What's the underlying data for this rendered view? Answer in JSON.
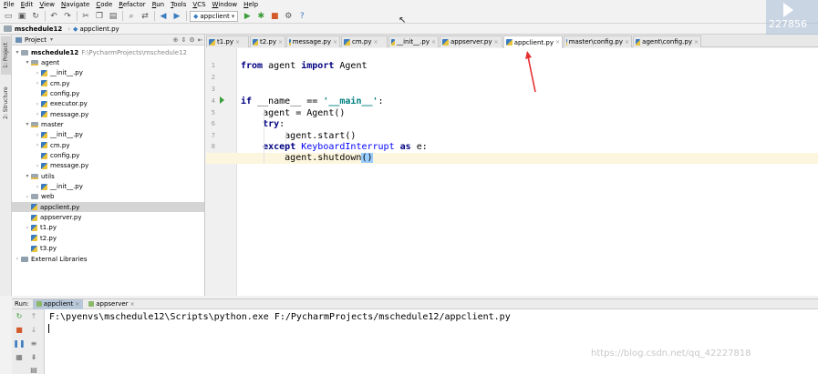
{
  "menu": [
    "File",
    "Edit",
    "View",
    "Navigate",
    "Code",
    "Refactor",
    "Run",
    "Tools",
    "VCS",
    "Window",
    "Help"
  ],
  "toolbar": {
    "run_config": "appclient",
    "icons": [
      "folder-open-icon",
      "save-icon",
      "sync-icon",
      "back-icon",
      "forward-icon",
      "cut-icon",
      "copy-icon",
      "paste-icon",
      "find-icon",
      "replace-icon",
      "nav-back-icon",
      "nav-forward-icon",
      "run-icon",
      "debug-icon",
      "stop-icon",
      "settings-icon",
      "help-icon"
    ]
  },
  "breadcrumb": {
    "project": "mschedule12",
    "file": "appclient.py"
  },
  "side_tabs": [
    "1: Project",
    "2: Structure"
  ],
  "project_panel": {
    "title": "Project",
    "tree": [
      {
        "depth": 0,
        "arrow": "▾",
        "icon": "folder",
        "label": "mschedule12",
        "path": "F:\\PycharmProjects\\mschedule12",
        "bold": true
      },
      {
        "depth": 1,
        "arrow": "▾",
        "icon": "pkg",
        "label": "agent"
      },
      {
        "depth": 2,
        "arrow": "›",
        "icon": "py",
        "label": "__init__.py"
      },
      {
        "depth": 2,
        "arrow": "›",
        "icon": "py",
        "label": "cm.py"
      },
      {
        "depth": 2,
        "arrow": "",
        "icon": "py",
        "label": "config.py"
      },
      {
        "depth": 2,
        "arrow": "›",
        "icon": "py",
        "label": "executor.py"
      },
      {
        "depth": 2,
        "arrow": "›",
        "icon": "py",
        "label": "message.py"
      },
      {
        "depth": 1,
        "arrow": "▾",
        "icon": "pkg",
        "label": "master"
      },
      {
        "depth": 2,
        "arrow": "›",
        "icon": "py",
        "label": "__init__.py"
      },
      {
        "depth": 2,
        "arrow": "›",
        "icon": "py",
        "label": "cm.py"
      },
      {
        "depth": 2,
        "arrow": "",
        "icon": "py",
        "label": "config.py"
      },
      {
        "depth": 2,
        "arrow": "›",
        "icon": "py",
        "label": "message.py"
      },
      {
        "depth": 1,
        "arrow": "▾",
        "icon": "pkg",
        "label": "utils"
      },
      {
        "depth": 2,
        "arrow": "›",
        "icon": "py",
        "label": "__init__.py"
      },
      {
        "depth": 1,
        "arrow": "›",
        "icon": "folder",
        "label": "web"
      },
      {
        "depth": 1,
        "arrow": "",
        "icon": "py",
        "label": "appclient.py",
        "selected": true
      },
      {
        "depth": 1,
        "arrow": "",
        "icon": "py",
        "label": "appserver.py"
      },
      {
        "depth": 1,
        "arrow": "›",
        "icon": "py",
        "label": "t1.py"
      },
      {
        "depth": 1,
        "arrow": "",
        "icon": "py",
        "label": "t2.py"
      },
      {
        "depth": 1,
        "arrow": "",
        "icon": "py",
        "label": "t3.py"
      },
      {
        "depth": 0,
        "arrow": "›",
        "icon": "lib",
        "label": "External Libraries"
      }
    ]
  },
  "editor_tabs": [
    {
      "label": "t1.py"
    },
    {
      "label": "t2.py"
    },
    {
      "label": "message.py"
    },
    {
      "label": "cm.py"
    },
    {
      "label": "__init__.py"
    },
    {
      "label": "appserver.py"
    },
    {
      "label": "appclient.py",
      "active": true
    },
    {
      "label": "master\\config.py"
    },
    {
      "label": "agent\\config.py"
    }
  ],
  "code": {
    "lines": [
      "1",
      "2",
      "3",
      "4",
      "5",
      "6",
      "7",
      "8",
      "9"
    ],
    "current_line": 9
  },
  "run_panel": {
    "label": "Run:",
    "tabs": [
      {
        "label": "appclient",
        "active": true
      },
      {
        "label": "appserver"
      }
    ],
    "command": "F:\\pyenvs\\mschedule12\\Scripts\\python.exe F:/PycharmProjects/mschedule12/appclient.py"
  },
  "overlay_text": "227856",
  "watermark": "https://blog.csdn.net/qq_42227818"
}
